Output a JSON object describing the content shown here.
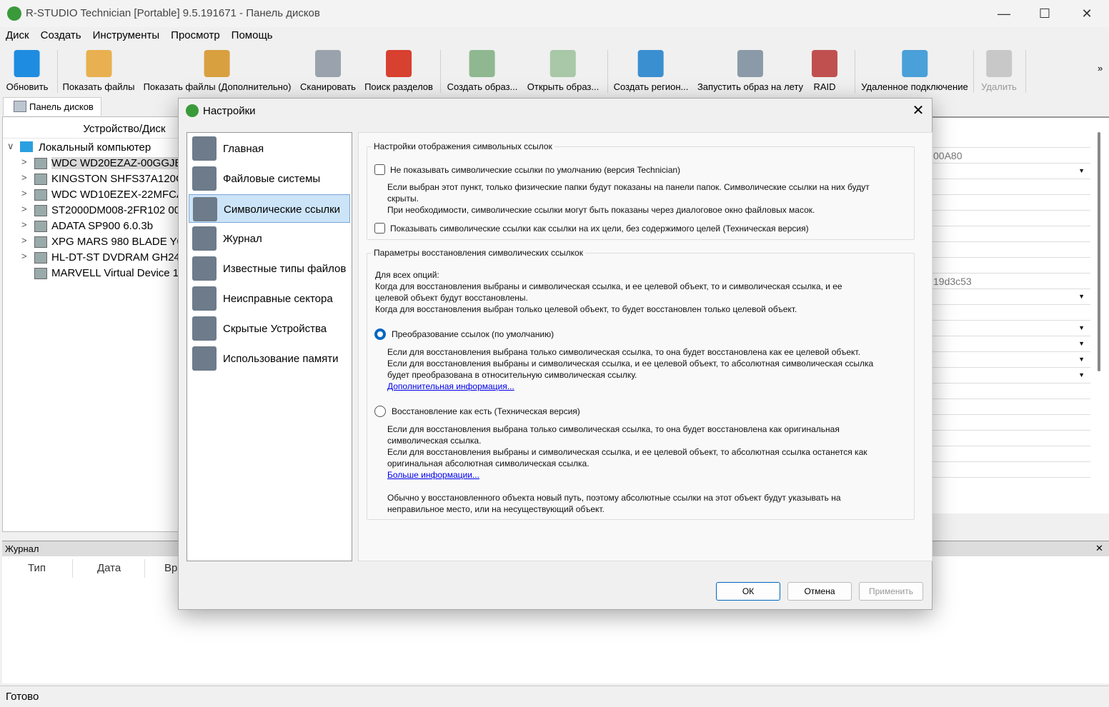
{
  "window": {
    "title": "R-STUDIO Technician [Portable] 9.5.191671 - Панель дисков",
    "minimize": "—",
    "maximize": "☐",
    "close": "✕"
  },
  "menu": [
    "Диск",
    "Создать",
    "Инструменты",
    "Просмотр",
    "Помощь"
  ],
  "toolbar": [
    {
      "label": "Обновить",
      "icon": "refresh-icon",
      "color": "#1e8ce0"
    },
    {
      "label": "Показать файлы",
      "icon": "show-files-icon",
      "color": "#e8b050"
    },
    {
      "label": "Показать файлы (Дополнительно)",
      "icon": "show-files-advanced-icon",
      "color": "#d9a040"
    },
    {
      "label": "Сканировать",
      "icon": "scan-icon",
      "color": "#9aa3ad"
    },
    {
      "label": "Поиск разделов",
      "icon": "find-partitions-icon",
      "color": "#d84030"
    },
    {
      "label": "Создать образ...",
      "icon": "create-image-icon",
      "color": "#8fb890"
    },
    {
      "label": "Открыть образ...",
      "icon": "open-image-icon",
      "color": "#a8c8a8"
    },
    {
      "label": "Создать регион...",
      "icon": "create-region-icon",
      "color": "#3a8fd0"
    },
    {
      "label": "Запустить образ на лету",
      "icon": "run-image-icon",
      "color": "#8a9aa8"
    },
    {
      "label": "RAID",
      "icon": "raid-icon",
      "color": "#c05050"
    },
    {
      "label": "Удаленное подключение",
      "icon": "remote-connect-icon",
      "color": "#4aa0d8"
    },
    {
      "label": "Удалить",
      "icon": "delete-icon",
      "color": "#c8c8c8",
      "disabled": true
    }
  ],
  "toolbar_overflow": "»",
  "panel_tab": "Панель дисков",
  "tree": {
    "header": "Устройство/Диск",
    "root": "Локальный компьютер",
    "items": [
      "WDC WD20EZAZ-00GGJB0",
      "KINGSTON SHFS37A120G",
      "WDC WD10EZEX-22MFCA0",
      "ST2000DM008-2FR102 0001",
      "ADATA SP900 6.0.3b",
      "XPG MARS 980 BLADE Y0",
      "HL-DT-ST DVDRAM GH24NSD1",
      "MARVELL Virtual Device 1"
    ]
  },
  "props": {
    "values": [
      "",
      "00A80",
      "",
      "",
      "",
      "",
      "",
      "",
      "",
      "19d3c53",
      "",
      "",
      "",
      "",
      "",
      "",
      "",
      "",
      "",
      "",
      "",
      ""
    ],
    "dropdown_rows": [
      2,
      10,
      12,
      13,
      14,
      15
    ]
  },
  "log": {
    "title": "Журнал",
    "columns": [
      "Тип",
      "Дата",
      "Вр"
    ],
    "close": "✕"
  },
  "status": "Готово",
  "dialog": {
    "title": "Настройки",
    "close": "✕",
    "nav": [
      {
        "label": "Главная",
        "icon": "home-icon"
      },
      {
        "label": "Файловые системы",
        "icon": "file-systems-icon"
      },
      {
        "label": "Символические ссылки",
        "icon": "symlinks-icon",
        "selected": true
      },
      {
        "label": "Журнал",
        "icon": "log-icon"
      },
      {
        "label": "Известные типы файлов",
        "icon": "known-file-types-icon"
      },
      {
        "label": "Неисправные сектора",
        "icon": "bad-sectors-icon"
      },
      {
        "label": "Скрытые Устройства",
        "icon": "hidden-devices-icon"
      },
      {
        "label": "Использование памяти",
        "icon": "memory-usage-icon"
      }
    ],
    "group1": {
      "title": "Настройки отображения символьных ссылок",
      "cb1": {
        "label": "Не показывать символические ссылки по умолчанию (версия Technician)",
        "checked": false
      },
      "cb1_desc": [
        "Если выбран этот пункт, только физические папки будут показаны на панели папок. Символические ссылки на них будут",
        "скрыты.",
        "При необходимости, символические ссылки могут быть показаны через диалоговое окно файловых масок."
      ],
      "cb2": {
        "label": "Показывать символические ссылки как ссылки на их цели, без содержимого целей (Техническая версия)",
        "checked": false
      }
    },
    "group2": {
      "title": "Параметры восстановления символических ссылкок",
      "intro": [
        "Для всех опций:",
        "Когда для восстановления выбраны и символическая ссылка, и ее целевой объект, то и символическая ссылка, и ее",
        "целевой объект будут восстановлены.",
        "Когда для восстановления выбран только целевой объект, то будет восстановлен только целевой объект."
      ],
      "rb1": {
        "label": "Преобразование ссылок (по умолчанию)",
        "selected": true
      },
      "rb1_desc": [
        "Если для восстановления выбрана только символическая ссылка, то она будет восстановлена как ее целевой объект.",
        "Если для восстановления выбраны и символическая ссылка, и ее целевой объект, то абсолютная символическая ссылка",
        "будет преобразована в относительную символическая ссылку."
      ],
      "rb1_link": "Дополнительная информация...",
      "rb2": {
        "label": "Восстановление как есть (Техническая версия)",
        "selected": false
      },
      "rb2_desc": [
        "Если для восстановления выбрана только символическая ссылка, то она будет восстановлена как оригинальная",
        "символическая ссылка.",
        "Если для восстановления выбраны и символическая ссылка, и ее целевой объект, то абсолютная ссылка останется как",
        "оригинальная абсолютная символическая ссылка."
      ],
      "rb2_link": "Больше информации...",
      "note": [
        "Обычно у восстановленного объекта новый путь, поэтому абсолютные ссылки на этот объект будут указывать на",
        "неправильное место, или на несуществующий объект."
      ]
    },
    "buttons": {
      "ok": "ОК",
      "cancel": "Отмена",
      "apply": "Применить"
    }
  }
}
